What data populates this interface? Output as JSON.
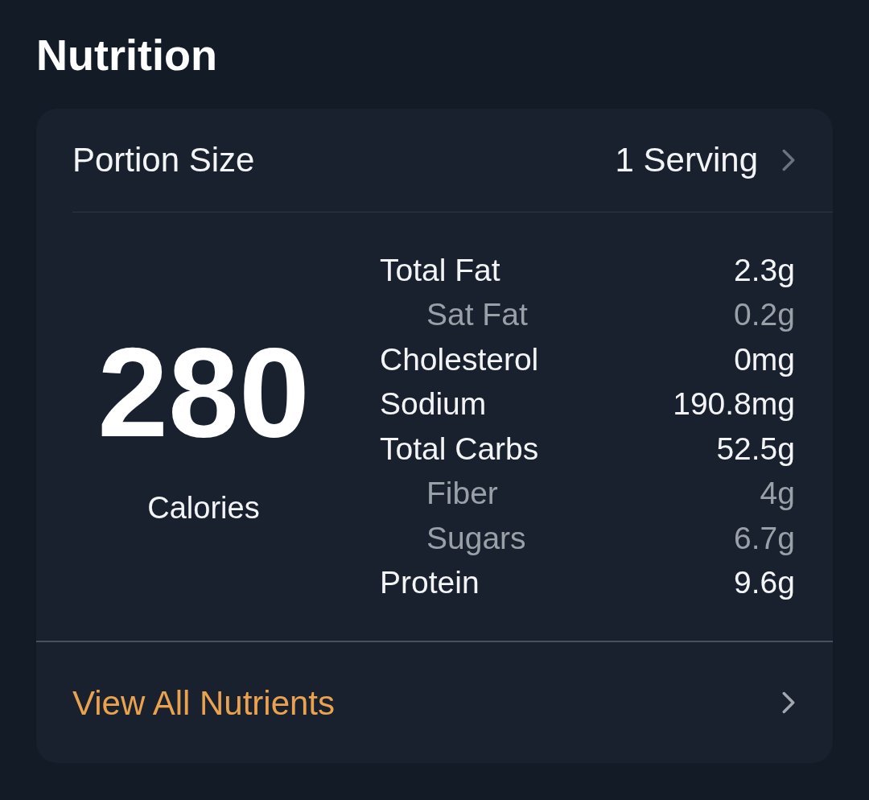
{
  "title": "Nutrition",
  "portion": {
    "label": "Portion Size",
    "value": "1 Serving"
  },
  "calories": {
    "value": "280",
    "label": "Calories"
  },
  "nutrients": [
    {
      "kind": "main",
      "name": "Total Fat",
      "amount": "2.3g"
    },
    {
      "kind": "sub",
      "name": "Sat Fat",
      "amount": "0.2g"
    },
    {
      "kind": "main",
      "name": "Cholesterol",
      "amount": "0mg"
    },
    {
      "kind": "main",
      "name": "Sodium",
      "amount": "190.8mg"
    },
    {
      "kind": "main",
      "name": "Total Carbs",
      "amount": "52.5g"
    },
    {
      "kind": "sub",
      "name": "Fiber",
      "amount": "4g"
    },
    {
      "kind": "sub",
      "name": "Sugars",
      "amount": "6.7g"
    },
    {
      "kind": "main",
      "name": "Protein",
      "amount": "9.6g"
    }
  ],
  "footer_link": {
    "label": "View All Nutrients"
  }
}
